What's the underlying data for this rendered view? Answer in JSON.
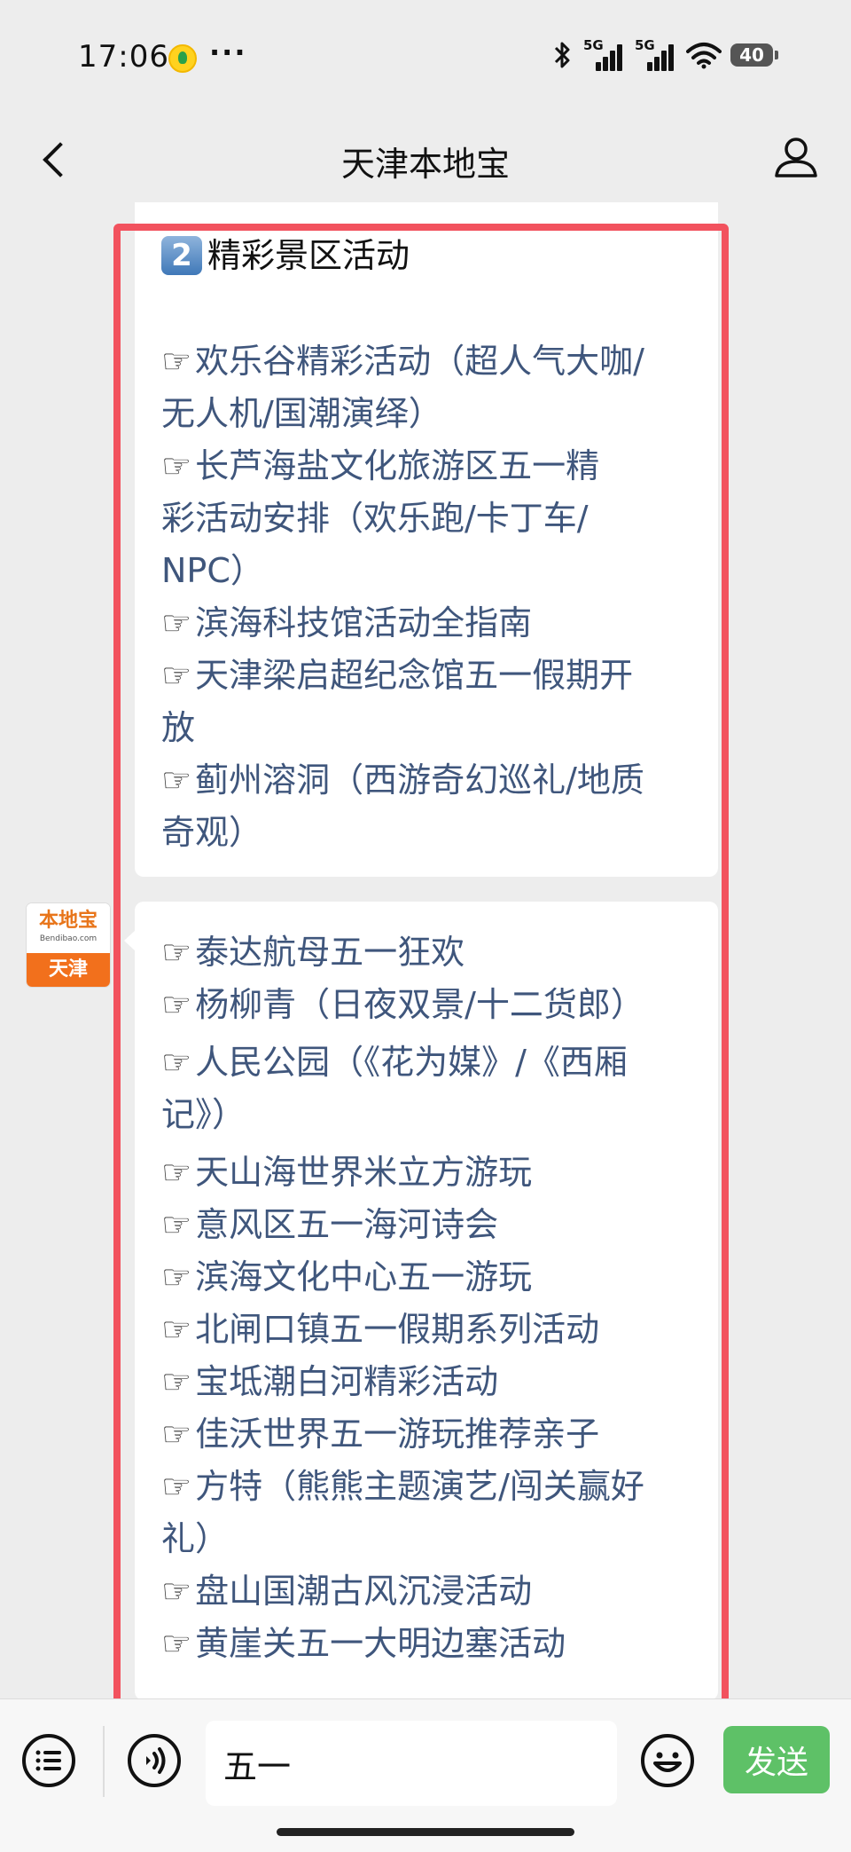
{
  "status_bar": {
    "time": "17:06",
    "more": "···",
    "network_1": "5G",
    "network_2": "5G",
    "battery": "40"
  },
  "nav": {
    "title": "天津本地宝"
  },
  "avatar": {
    "brand_main": "本地宝",
    "brand_sub": "Bendibao.com",
    "city": "天津"
  },
  "message_1": {
    "section_number": "2",
    "section_title": "精彩景区活动",
    "items": [
      [
        "☞",
        "欢乐谷精彩活动（超人气大咖/",
        "无人机/国潮演绎）"
      ],
      [
        "☞",
        "长芦海盐文化旅游区五一精",
        "彩活动安排（欢乐跑/卡丁车/",
        "NPC）"
      ],
      [
        "☞",
        "滨海科技馆活动全指南"
      ],
      [
        "☞",
        "天津梁启超纪念馆五一假期开",
        "放"
      ],
      [
        "☞",
        "蓟州溶洞（西游奇幻巡礼/地质",
        "奇观）"
      ]
    ]
  },
  "message_2": {
    "items": [
      [
        "☞",
        "泰达航母五一狂欢"
      ],
      [
        "☞",
        "杨柳青（日夜双景/十二货郎）"
      ],
      [
        "☞",
        "人民公园（《花为媒》/《西厢",
        "记》）"
      ],
      [
        "☞",
        "天山海世界米立方游玩"
      ],
      [
        "☞",
        "意风区五一海河诗会"
      ],
      [
        "☞",
        "滨海文化中心五一游玩"
      ],
      [
        "☞",
        "北闸口镇五一假期系列活动"
      ],
      [
        "☞",
        "宝坻潮白河精彩活动"
      ],
      [
        "☞",
        "佳沃世界五一游玩推荐亲子"
      ],
      [
        "☞",
        "方特（熊熊主题演艺/闯关赢好",
        "礼）"
      ],
      [
        "☞",
        "盘山国潮古风沉浸活动"
      ],
      [
        "☞",
        "黄崖关五一大明边塞活动"
      ]
    ]
  },
  "input_bar": {
    "input_value": "五一",
    "send_label": "发送"
  },
  "colors": {
    "highlight_border": "#f2525e",
    "link_text": "#3f567c",
    "send_button": "#5ec167",
    "brand_orange": "#f2701c"
  }
}
